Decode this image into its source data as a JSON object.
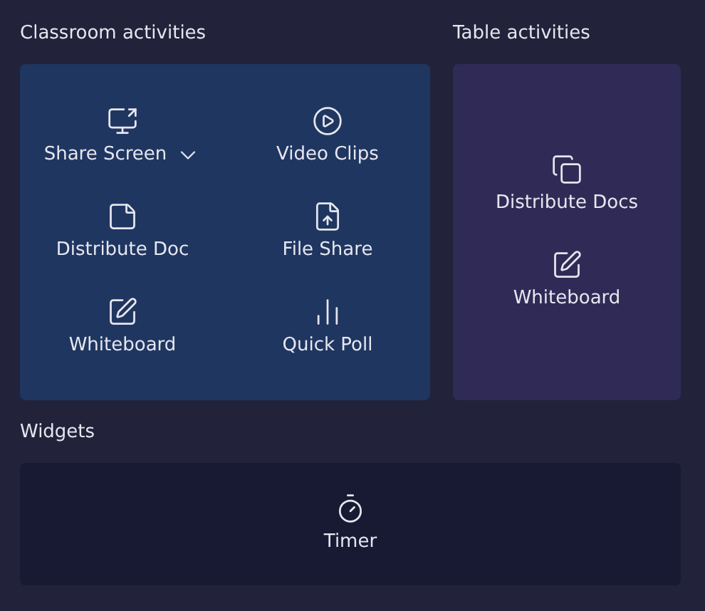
{
  "sections": [
    {
      "title": "Classroom activities",
      "items": [
        {
          "label": "Share Screen",
          "kind": "screen",
          "dropdown": true
        },
        {
          "label": "Video Clips",
          "kind": "video",
          "dropdown": false
        },
        {
          "label": "Distribute Doc",
          "kind": "doc",
          "dropdown": false
        },
        {
          "label": "File Share",
          "kind": "upload",
          "dropdown": false
        },
        {
          "label": "Whiteboard",
          "kind": "whiteboard",
          "dropdown": false
        },
        {
          "label": "Quick Poll",
          "kind": "poll",
          "dropdown": false
        }
      ]
    },
    {
      "title": "Table activities",
      "items": [
        {
          "label": "Distribute Docs",
          "kind": "docs",
          "dropdown": false
        },
        {
          "label": "Whiteboard",
          "kind": "whiteboard",
          "dropdown": false
        }
      ]
    },
    {
      "title": "Widgets",
      "items": [
        {
          "label": "Timer",
          "kind": "timer",
          "dropdown": false
        }
      ]
    }
  ]
}
